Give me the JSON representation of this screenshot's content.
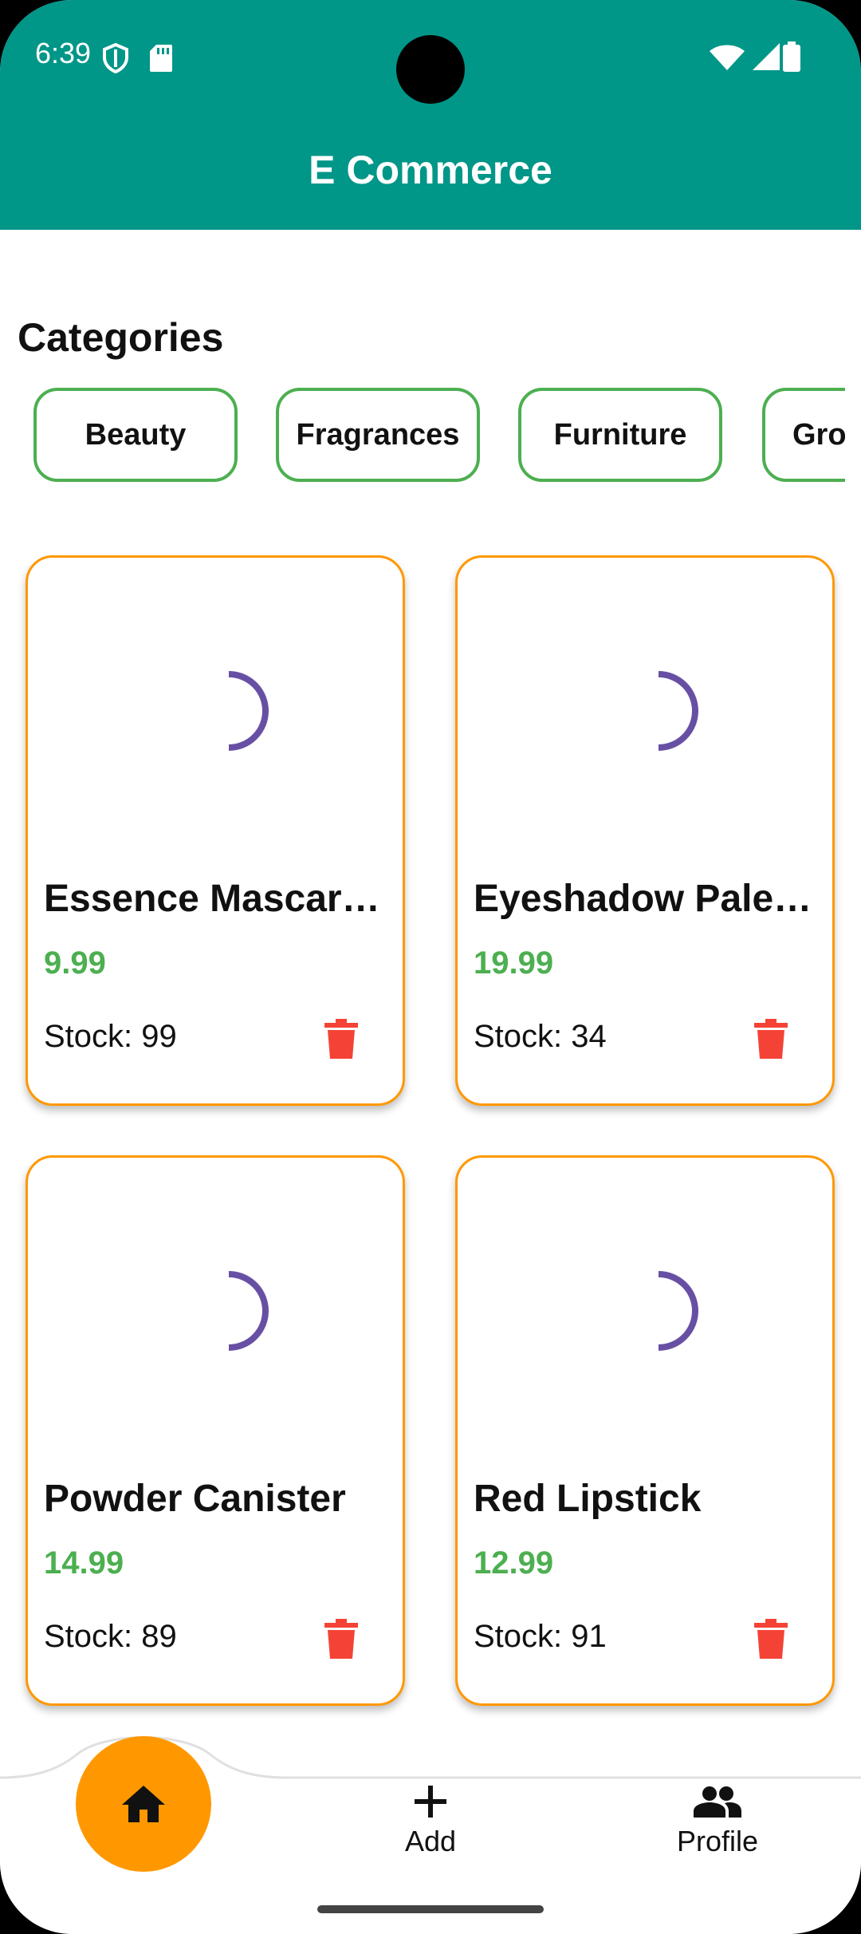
{
  "status_bar": {
    "time": "6:39",
    "icons": [
      "shield-icon",
      "sd-card-icon",
      "wifi-icon",
      "signal-icon",
      "battery-icon"
    ]
  },
  "app_bar": {
    "title": "E Commerce",
    "color": "#009688"
  },
  "categories": {
    "title": "Categories",
    "items": [
      {
        "label": "Beauty"
      },
      {
        "label": "Fragrances"
      },
      {
        "label": "Furniture"
      },
      {
        "label": "Gro"
      }
    ],
    "chip_border_color": "#4caf50"
  },
  "products": [
    {
      "name": "Essence Mascara …",
      "price": "9.99",
      "stock": "Stock: 99"
    },
    {
      "name": "Eyeshadow Palett…",
      "price": "19.99",
      "stock": "Stock: 34"
    },
    {
      "name": "Powder Canister",
      "price": "14.99",
      "stock": "Stock: 89"
    },
    {
      "name": "Red Lipstick",
      "price": "12.99",
      "stock": "Stock: 91"
    }
  ],
  "colors": {
    "card_border": "#ff9800",
    "price": "#4caf50",
    "delete_icon": "#f44336",
    "spinner": "#6750a4",
    "fab": "#ff9800"
  },
  "bottom_nav": {
    "items": [
      {
        "icon": "home-icon",
        "label": ""
      },
      {
        "icon": "plus-icon",
        "label": "Add"
      },
      {
        "icon": "people-icon",
        "label": "Profile"
      }
    ]
  }
}
